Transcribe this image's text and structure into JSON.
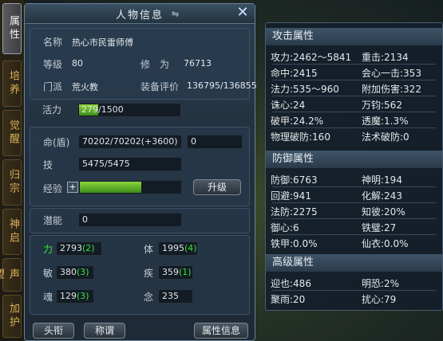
{
  "tabs": [
    "属性",
    "培养",
    "觉醒",
    "归宗",
    "神启",
    "声望",
    "加护"
  ],
  "panel": {
    "title": "人物信息",
    "name_label": "名称",
    "name_value": "热心市民雷师傅",
    "level_label": "等级",
    "level_value": "80",
    "xiuwei_label": "修　为",
    "xiuwei_value": "76713",
    "sect_label": "门派",
    "sect_value": "荒火教",
    "rating_label": "装备评价",
    "rating_value": "136795/136855",
    "vitality_label": "活力",
    "vitality_value": "279/1500",
    "vitality_ratio": 0.186,
    "hp_label": "命(盾)",
    "hp_value": "70202/70202(+3600)",
    "shield_value": "0",
    "skill_label": "技",
    "skill_value": "5475/5475",
    "exp_label": "经验",
    "exp_plus": "+",
    "exp_ratio": 0.6,
    "upgrade_label": "升级",
    "potential_label": "潜能",
    "potential_value": "0",
    "stats": {
      "li_label": "力",
      "li_value": "2793",
      "li_bonus": "(2)",
      "ti_label": "体",
      "ti_value": "1995",
      "ti_bonus": "(4)",
      "min_label": "敏",
      "min_value": "380",
      "min_bonus": "(3)",
      "ji_label": "疾",
      "ji_value": "359",
      "ji_bonus": "(1)",
      "hun_label": "魂",
      "hun_value": "129",
      "hun_bonus": "(3)",
      "nian_label": "念",
      "nian_value": "235"
    },
    "btn_touxian": "头衔",
    "btn_chengwei": "称谓",
    "btn_attr": "属性信息"
  },
  "right": {
    "attack_head": "攻击属性",
    "attack": [
      [
        "攻力:2462～5841",
        "重击:2134"
      ],
      [
        "命中:2415",
        "会心一击:353"
      ],
      [
        "法力:535～960",
        "附加伤害:322"
      ],
      [
        "诛心:24",
        "万钧:562"
      ],
      [
        "破甲:24.2%",
        "透魔:1.3%"
      ],
      [
        "物理破防:160",
        "法术破防:0"
      ]
    ],
    "defense_head": "防御属性",
    "defense": [
      [
        "防御:6763",
        "神明:194"
      ],
      [
        "回避:941",
        "化解:243"
      ],
      [
        "法防:2275",
        "知彼:20%"
      ],
      [
        "御心:6",
        "铁璧:27"
      ],
      [
        "铁甲:0.0%",
        "仙衣:0.0%"
      ]
    ],
    "adv_head": "高级属性",
    "adv": [
      [
        "迎也:486",
        "明恐:2%"
      ],
      [
        "聚雨:20",
        "扰心:79"
      ]
    ]
  }
}
